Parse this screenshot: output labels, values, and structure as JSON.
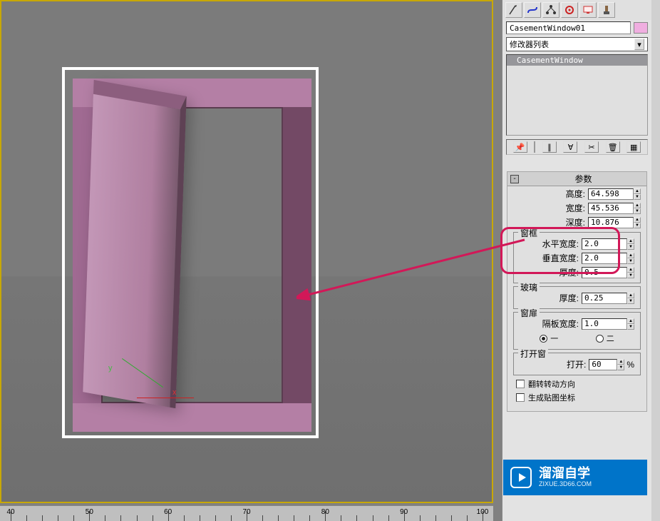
{
  "object_name": "CasementWindow01",
  "modifier_dropdown": "修改器列表",
  "modifier_stack_item": "CasementWindow",
  "axes": {
    "x": "x",
    "y": "y"
  },
  "rollout_title": "参数",
  "dims": {
    "height_label": "高度:",
    "height_value": "64.598",
    "width_label": "宽度:",
    "width_value": "45.536",
    "depth_label": "深度:",
    "depth_value": "10.876"
  },
  "frame": {
    "group": "窗框",
    "h_label": "水平宽度:",
    "h_value": "2.0",
    "v_label": "垂直宽度:",
    "v_value": "2.0",
    "t_label": "厚度:",
    "t_value": "0.5"
  },
  "glass": {
    "group": "玻璃",
    "t_label": "厚度:",
    "t_value": "0.25"
  },
  "casement": {
    "group": "窗扉",
    "panel_label": "隔板宽度:",
    "panel_value": "1.0",
    "opt_one": "一",
    "opt_two": "二"
  },
  "open": {
    "group": "打开窗",
    "label": "打开:",
    "value": "60",
    "pct": "%"
  },
  "flip_label": "翻转转动方向",
  "genmap_label": "生成贴图坐标",
  "ruler": {
    "ticks": [
      40,
      50,
      60,
      70,
      80,
      90,
      100
    ]
  },
  "watermark": {
    "big": "溜溜自学",
    "small": "ZIXUE.3D66.COM"
  },
  "icons": {
    "arrow": "arrow-icon",
    "curve": "curve-icon",
    "link": "link-icon",
    "hierarchy": "hierarchy-icon",
    "display": "display-icon",
    "utilities": "utilities-icon",
    "hammer": "hammer-icon",
    "pin": "pin-icon",
    "stack1": "stack1-icon",
    "stack2": "stack2-icon",
    "scissors": "scissors-icon",
    "trash": "trash-icon",
    "config": "config-icon"
  }
}
